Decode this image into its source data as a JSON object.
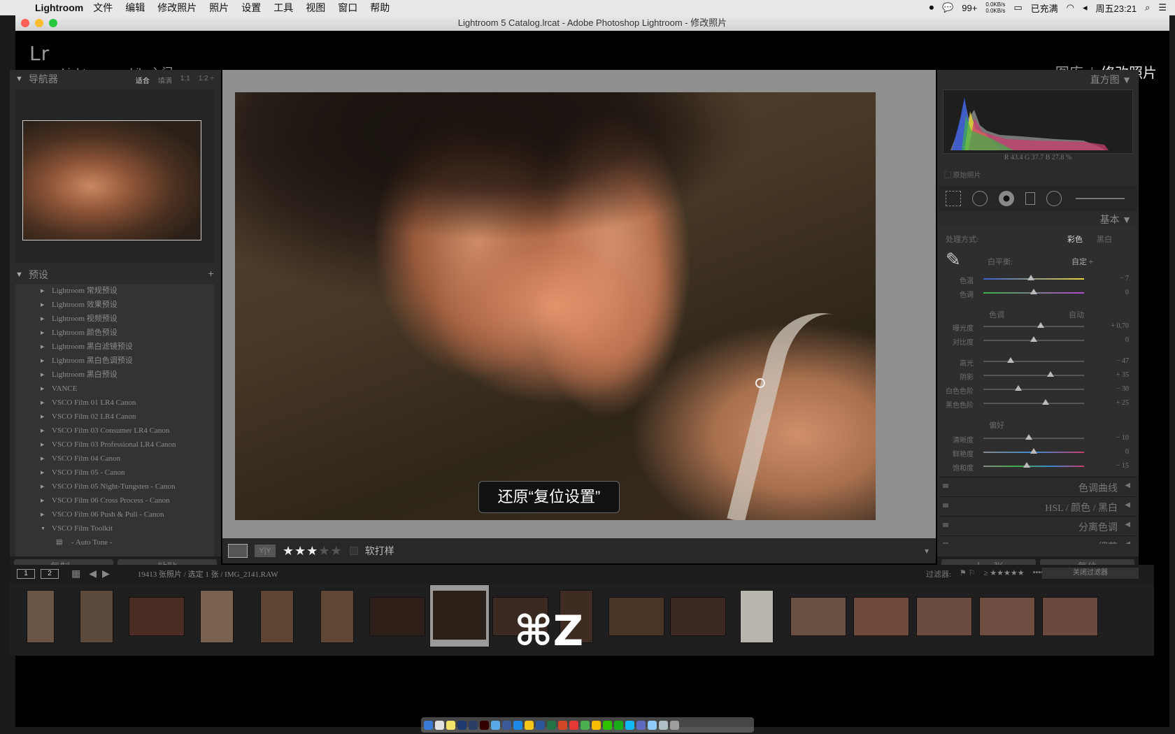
{
  "menubar": {
    "app": "Lightroom",
    "items": [
      "文件",
      "编辑",
      "修改照片",
      "照片",
      "设置",
      "工具",
      "视图",
      "窗口",
      "帮助"
    ],
    "wechat_badge": "99+",
    "net_up": "0.0KB/s",
    "net_down": "0.0KB/s",
    "battery": "已充满",
    "clock": "周五23:21"
  },
  "window": {
    "title": "Lightroom 5 Catalog.lrcat - Adobe Photoshop Lightroom - 修改照片"
  },
  "identity": {
    "logo": "Lr",
    "mobile": "Lightroom mobile 入门 ▸",
    "module_library": "图库",
    "module_separator": "|",
    "module_develop": "修改照片"
  },
  "navigator": {
    "title": "导航器",
    "modes": [
      "适合",
      "填满",
      "1:1",
      "1:2 ÷"
    ]
  },
  "presets": {
    "title": "预设",
    "add": "+",
    "items": [
      "Lightroom 常规预设",
      "Lightroom 效果预设",
      "Lightroom 视频预设",
      "Lightroom 颜色预设",
      "Lightroom 黑白滤镜预设",
      "Lightroom 黑白色调预设",
      "Lightroom 黑白预设",
      "VANCE",
      "VSCO Film 01 LR4 Canon",
      "VSCO Film 02 LR4 Canon",
      "VSCO Film 03 Consumer LR4 Canon",
      "VSCO Film 03 Professional LR4 Canon",
      "VSCO Film 04 Canon",
      "VSCO Film 05 - Canon",
      "VSCO Film 05 Night-Tungsten - Canon",
      "VSCO Film 06 Cross Process - Canon",
      "VSCO Film 06 Push & Pull - Canon",
      "VSCO Film Toolkit"
    ],
    "sub_item": "- Auto Tone -",
    "copy_button": "复制...",
    "paste_button": "粘贴"
  },
  "photo": {
    "toast": "还原“复位设置”",
    "shortcut": "⌘Z"
  },
  "toolbar": {
    "compare_label": "Y|Y",
    "rating": 3,
    "stars_on": "★★★",
    "stars_off": "★★",
    "softproof": "软打样"
  },
  "histogram": {
    "title": "直方图",
    "values": "R 43.4  G 37.7  B 27.8 %",
    "original": "原始照片"
  },
  "basic": {
    "title": "基本",
    "treatment_label": "处理方式:",
    "color": "彩色",
    "bw": "黑白",
    "wb_label": "白平衡:",
    "wb_value": "自定 ÷",
    "tone_label": "色调",
    "auto": "自动",
    "presence_label": "偏好",
    "sliders": [
      {
        "label": "色温",
        "value": "− 7",
        "pos": 0.47
      },
      {
        "label": "色调",
        "value": "0",
        "pos": 0.5
      },
      {
        "label": "曝光度",
        "value": "+ 0.70",
        "pos": 0.57
      },
      {
        "label": "对比度",
        "value": "0",
        "pos": 0.5
      },
      {
        "label": "高光",
        "value": "− 47",
        "pos": 0.27
      },
      {
        "label": "阴影",
        "value": "+ 35",
        "pos": 0.67
      },
      {
        "label": "白色色阶",
        "value": "− 30",
        "pos": 0.35
      },
      {
        "label": "黑色色阶",
        "value": "+ 25",
        "pos": 0.62
      },
      {
        "label": "清晰度",
        "value": "− 10",
        "pos": 0.45
      },
      {
        "label": "鲜艳度",
        "value": "0",
        "pos": 0.5
      },
      {
        "label": "饱和度",
        "value": "− 15",
        "pos": 0.43
      }
    ]
  },
  "collapsed_panels": {
    "tone_curve": "色调曲线",
    "hsl": "HSL / 颜色 / 黑白",
    "split_toning": "分离色调",
    "detail": "细节"
  },
  "right_buttons": {
    "previous": "上一张",
    "reset": "复位"
  },
  "filmstrip": {
    "page1": "1",
    "page2": "2",
    "info": "19413 张照片 / 选定 1 张 / IMG_2141.RAW",
    "filter_label": "过滤器:",
    "filter_stars": "≥ ★★★★★",
    "filter_select": "关闭过滤器"
  }
}
